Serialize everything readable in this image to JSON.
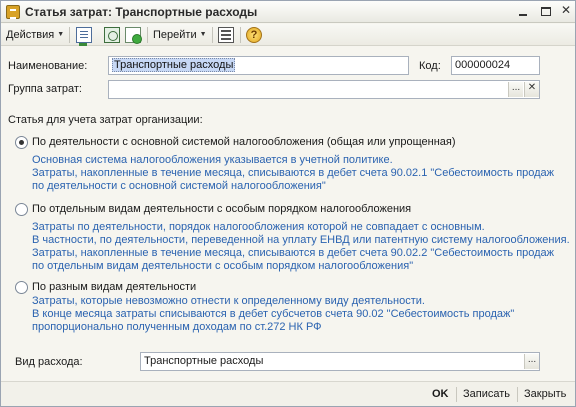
{
  "window": {
    "title": "Статья затрат: Транспортные расходы"
  },
  "toolbar": {
    "actions_label": "Действия",
    "goto_label": "Перейти",
    "help_glyph": "?"
  },
  "form": {
    "name_label": "Наименование:",
    "name_value": "Транспортные расходы",
    "code_label": "Код:",
    "code_value": "000000024",
    "group_label": "Группа затрат:",
    "group_value": "",
    "section_title": "Статья для учета затрат организации:",
    "options": [
      {
        "label": "По деятельности с основной системой налогообложения (общая или упрощенная)",
        "selected": true,
        "description": [
          "Основная система налогообложения указывается в учетной политике.",
          "Затраты, накопленные в течение месяца, списываются в дебет счета 90.02.1 \"Себестоимость продаж",
          "по деятельности с основной системой налогообложения\""
        ]
      },
      {
        "label": "По отдельным видам деятельности с особым порядком налогообложения",
        "selected": false,
        "description": [
          "Затраты по деятельности, порядок налогообложения которой не совпадает с основным.",
          "В частности, по деятельности, переведенной на уплату ЕНВД или патентную систему налогообложения.",
          "Затраты, накопленные в течение месяца, списываются в дебет счета 90.02.2 \"Себестоимость продаж",
          "по отдельным видам деятельности с особым порядком налогообложения\""
        ]
      },
      {
        "label": "По разным видам деятельности",
        "selected": false,
        "description": [
          "Затраты, которые невозможно отнести к определенному виду деятельности.",
          "В конце месяца затраты списываются в дебет субсчетов счета 90.02 \"Себестоимость продаж\"",
          "пропорционально полученным доходам по ст.272 НК РФ"
        ]
      }
    ],
    "expense_type_label": "Вид расхода:",
    "expense_type_value": "Транспортные расходы",
    "ellipsis": "...",
    "clear_glyph": "✕"
  },
  "footer": {
    "ok_label": "OK",
    "save_label": "Записать",
    "close_label": "Закрыть"
  },
  "colors": {
    "description_text": "#2b63b0",
    "selection_bg": "#c7d8f5"
  }
}
